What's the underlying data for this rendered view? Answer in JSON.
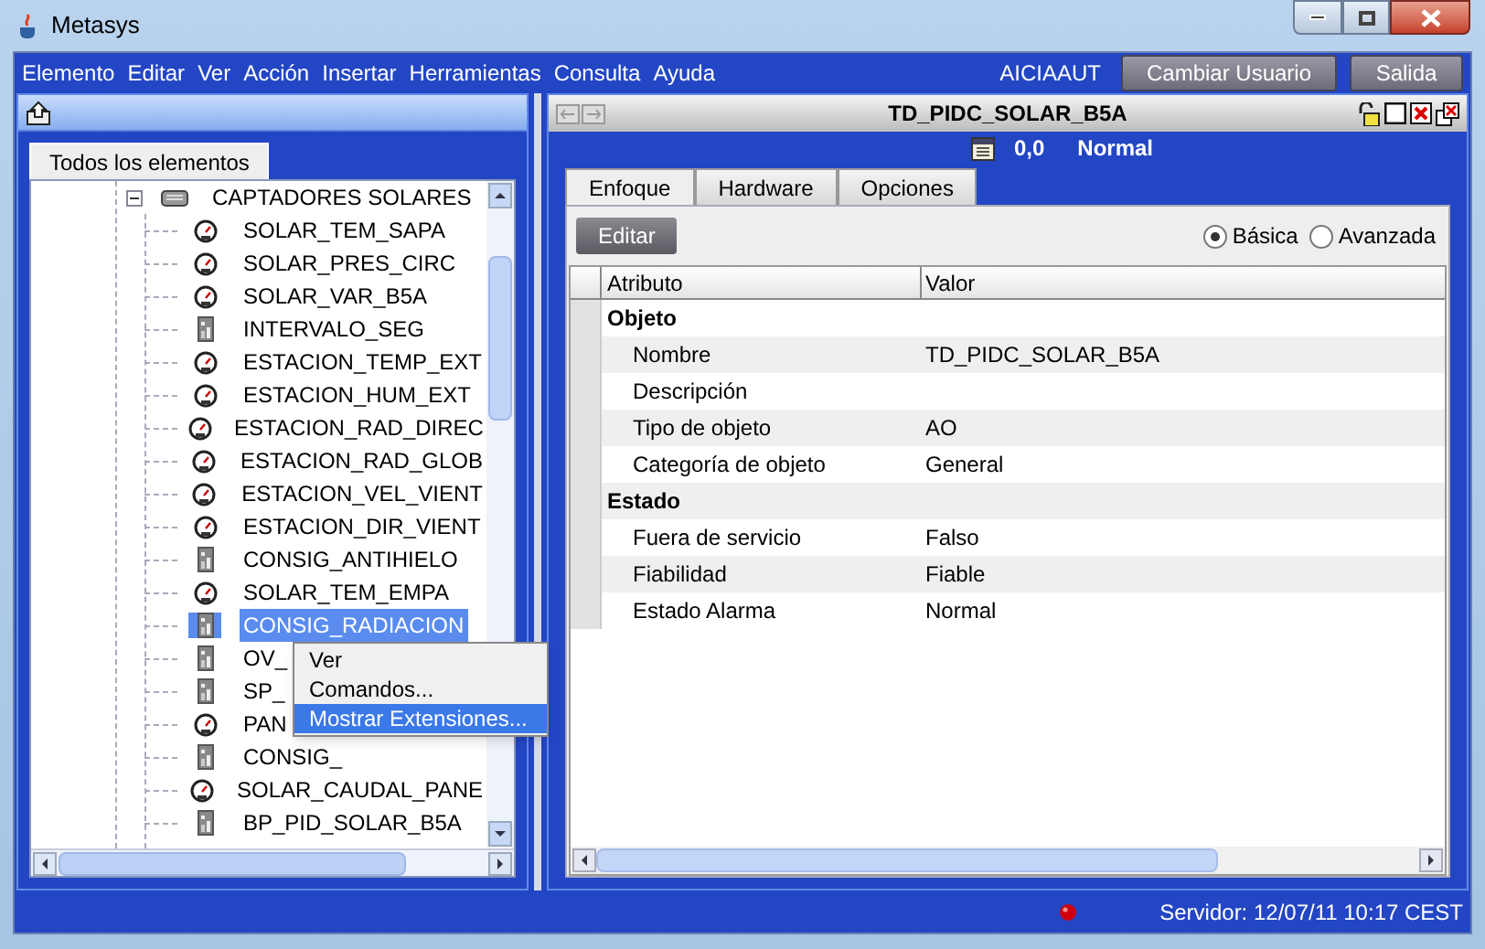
{
  "window": {
    "title": "Metasys"
  },
  "menu_bar": {
    "items": [
      "Elemento",
      "Editar",
      "Ver",
      "Acción",
      "Insertar",
      "Herramientas",
      "Consulta",
      "Ayuda"
    ],
    "user": "AICIAAUT",
    "buttons": [
      "Cambiar Usuario",
      "Salida"
    ]
  },
  "left_panel": {
    "tab": "Todos los elementos",
    "tree": [
      {
        "label": "CAPTADORES SOLARES",
        "kind": "folder",
        "expanded": true,
        "selected": false,
        "children": [
          {
            "label": "SOLAR_TEM_SAPA",
            "kind": "analog",
            "selected": false
          },
          {
            "label": "SOLAR_PRES_CIRC",
            "kind": "analog",
            "selected": false
          },
          {
            "label": "SOLAR_VAR_B5A",
            "kind": "analog",
            "selected": false
          },
          {
            "label": "INTERVALO_SEG",
            "kind": "setpoint",
            "selected": false
          },
          {
            "label": "ESTACION_TEMP_EXT",
            "kind": "analog",
            "selected": false
          },
          {
            "label": "ESTACION_HUM_EXT",
            "kind": "analog",
            "selected": false
          },
          {
            "label": "ESTACION_RAD_DIREC",
            "kind": "analog",
            "selected": false
          },
          {
            "label": "ESTACION_RAD_GLOB",
            "kind": "analog",
            "selected": false
          },
          {
            "label": "ESTACION_VEL_VIENT",
            "kind": "analog",
            "selected": false
          },
          {
            "label": "ESTACION_DIR_VIENT",
            "kind": "analog",
            "selected": false
          },
          {
            "label": "CONSIG_ANTIHIELO",
            "kind": "setpoint",
            "selected": false
          },
          {
            "label": "SOLAR_TEM_EMPA",
            "kind": "analog",
            "selected": false
          },
          {
            "label": "CONSIG_RADIACION",
            "kind": "setpoint",
            "selected": true
          },
          {
            "label": "OV_",
            "kind": "setpoint",
            "selected": false
          },
          {
            "label": "SP_",
            "kind": "setpoint",
            "selected": false
          },
          {
            "label": "PAN",
            "kind": "analog",
            "selected": false
          },
          {
            "label": "CONSIG_",
            "kind": "setpoint",
            "selected": false
          },
          {
            "label": "SOLAR_CAUDAL_PANE",
            "kind": "analog",
            "selected": false
          },
          {
            "label": "BP_PID_SOLAR_B5A",
            "kind": "setpoint",
            "selected": false
          }
        ]
      }
    ]
  },
  "context_menu": [
    {
      "label": "Ver",
      "selected": false
    },
    {
      "label": "Comandos...",
      "selected": false
    },
    {
      "label": "Mostrar Extensiones...",
      "selected": true
    }
  ],
  "detail_panel": {
    "title": "TD_PIDC_SOLAR_B5A",
    "value": "0,0",
    "status": "Normal",
    "tabs": [
      {
        "label": "Enfoque",
        "selected": true
      },
      {
        "label": "Hardware",
        "selected": false
      },
      {
        "label": "Opciones",
        "selected": false
      }
    ],
    "edit_button": "Editar",
    "view_modes": [
      {
        "label": "Básica",
        "selected": true
      },
      {
        "label": "Avanzada",
        "selected": false
      }
    ],
    "table": {
      "columns": [
        "Atributo",
        "Valor"
      ],
      "rows": [
        {
          "kind": "group",
          "attribute": "Objeto"
        },
        {
          "kind": "attribute",
          "attribute": "Nombre",
          "value": "TD_PIDC_SOLAR_B5A"
        },
        {
          "kind": "attribute",
          "attribute": "Descripción"
        },
        {
          "kind": "attribute",
          "attribute": "Tipo de objeto",
          "value": "AO"
        },
        {
          "kind": "attribute",
          "attribute": "Categoría de objeto",
          "value": "General"
        },
        {
          "kind": "group",
          "attribute": "Estado"
        },
        {
          "kind": "attribute",
          "attribute": "Fuera de servicio",
          "value": "Falso"
        },
        {
          "kind": "attribute",
          "attribute": "Fiabilidad",
          "value": "Fiable"
        },
        {
          "kind": "attribute",
          "attribute": "Estado Alarma",
          "value": "Normal"
        }
      ]
    }
  },
  "status_bar": {
    "server": "Servidor: 12/07/11 10:17 CEST"
  }
}
